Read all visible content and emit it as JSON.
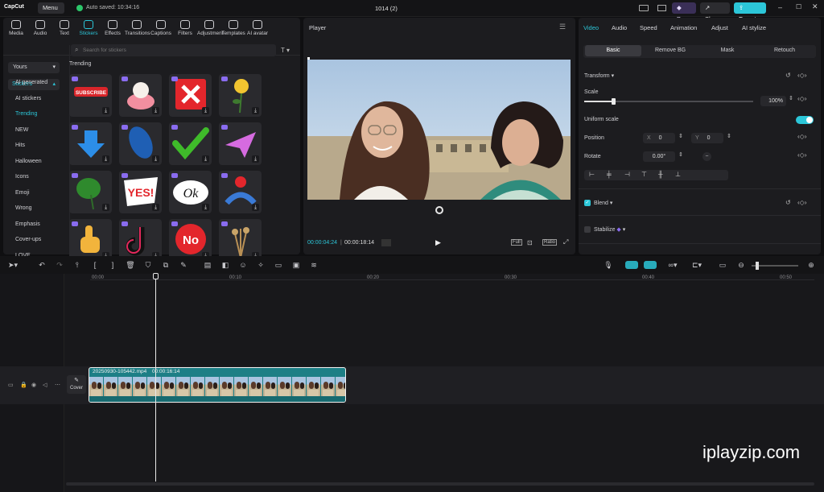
{
  "app": {
    "name": "CapCut",
    "menu_label": "Menu",
    "autosave": "Auto saved: 10:34:16",
    "project_title": "1014 (2)",
    "pro_label": "Pro",
    "share_label": "Share",
    "export_label": "Export"
  },
  "toolbar_tabs": [
    {
      "label": "Media",
      "icon": "media-icon"
    },
    {
      "label": "Audio",
      "icon": "audio-icon"
    },
    {
      "label": "Text",
      "icon": "text-icon"
    },
    {
      "label": "Stickers",
      "icon": "stickers-icon"
    },
    {
      "label": "Effects",
      "icon": "effects-icon"
    },
    {
      "label": "Transitions",
      "icon": "transitions-icon"
    },
    {
      "label": "Captions",
      "icon": "captions-icon"
    },
    {
      "label": "Filters",
      "icon": "filters-icon"
    },
    {
      "label": "Adjustment",
      "icon": "adjustment-icon"
    },
    {
      "label": "Templates",
      "icon": "templates-icon"
    },
    {
      "label": "AI avatar",
      "icon": "ai-avatar-icon"
    }
  ],
  "sidebar": {
    "yours": "Yours",
    "stickers": "Stickers",
    "items": [
      "AI generated",
      "AI stickers",
      "Trending",
      "NEW",
      "Hits",
      "Halloween",
      "Icons",
      "Emoji",
      "Wrong",
      "Emphasis",
      "Cover-ups",
      "LOVE"
    ]
  },
  "search": {
    "placeholder": "Search for stickers"
  },
  "section_title": "Trending",
  "stickers": [
    "subscribe",
    "cake",
    "red-x",
    "yellow-rose",
    "down-arrow",
    "blue-leaf",
    "checkmark",
    "paper-plane",
    "monstera",
    "yes",
    "ok",
    "heart-hands",
    "thumbs-up",
    "tiktok",
    "no",
    "dried-flowers"
  ],
  "sticker_texts": {
    "subscribe": "SUBSCRIBE",
    "yes": "YES!",
    "ok": "Ok",
    "no": "No"
  },
  "player": {
    "title": "Player",
    "current_time": "00:00:04:24",
    "total_time": "00:00:18:14",
    "full_label": "Full",
    "ratio_label": "Ratio"
  },
  "right_tabs": [
    "Video",
    "Audio",
    "Speed",
    "Animation",
    "Adjust",
    "AI stylize"
  ],
  "sub_tabs": [
    "Basic",
    "Remove BG",
    "Mask",
    "Retouch"
  ],
  "props": {
    "transform": "Transform",
    "scale": "Scale",
    "scale_value": "100%",
    "scale_fraction": 0.17,
    "uniform": "Uniform scale",
    "position": "Position",
    "x_label": "X",
    "x_value": "0",
    "y_label": "Y",
    "y_value": "0",
    "rotate": "Rotate",
    "rotate_value": "0.00°",
    "blend": "Blend",
    "stabilize": "Stabilize"
  },
  "timeline": {
    "ruler": [
      "00:00",
      "00:10",
      "00:20",
      "00:30",
      "00:40",
      "00:50"
    ],
    "clip_name": "20250930-105442.mp4",
    "clip_duration": "00:00:16:14",
    "cover_label": "Cover"
  },
  "watermark": "iplayzip.com",
  "colors": {
    "accent": "#2cc6d8",
    "clip": "#1d7f86"
  }
}
